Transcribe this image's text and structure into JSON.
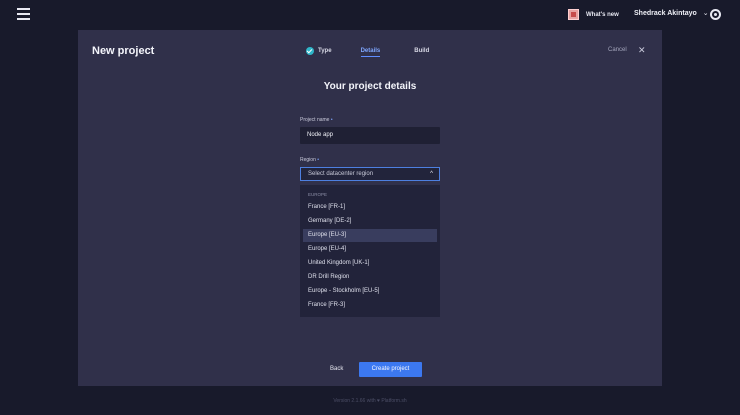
{
  "topbar": {
    "menu_icon": "hamburger-menu-icon",
    "whats_new_label": "What's new",
    "user_name": "Shedrack Akintayo",
    "settings_icon": "gear-icon"
  },
  "modal": {
    "title": "New project",
    "steps": {
      "type": "Type",
      "details": "Details",
      "build": "Build"
    },
    "cancel_label": "Cancel",
    "close_symbol": "✕",
    "section_title": "Your project details",
    "project_name": {
      "label": "Project name",
      "required_mark": "•",
      "value": "Node app"
    },
    "region": {
      "label": "Region",
      "required_mark": "•",
      "placeholder": "Select datacenter region",
      "group_label": "EUROPE",
      "options": [
        "France [FR-1]",
        "Germany [DE-2]",
        "Europe [EU-3]",
        "Europe [EU-4]",
        "United Kingdom [UK-1]",
        "DR Drill Region",
        "Europe - Stockholm [EU-5]",
        "France [FR-3]"
      ],
      "highlighted_option": "Europe [EU-3]"
    },
    "back_label": "Back",
    "create_label": "Create project"
  },
  "footer": {
    "text": "Version 2.1.66 with ♥ Platform.sh"
  },
  "colors": {
    "accent": "#3c78f0",
    "background": "#181a2b",
    "modal": "#30304a"
  }
}
